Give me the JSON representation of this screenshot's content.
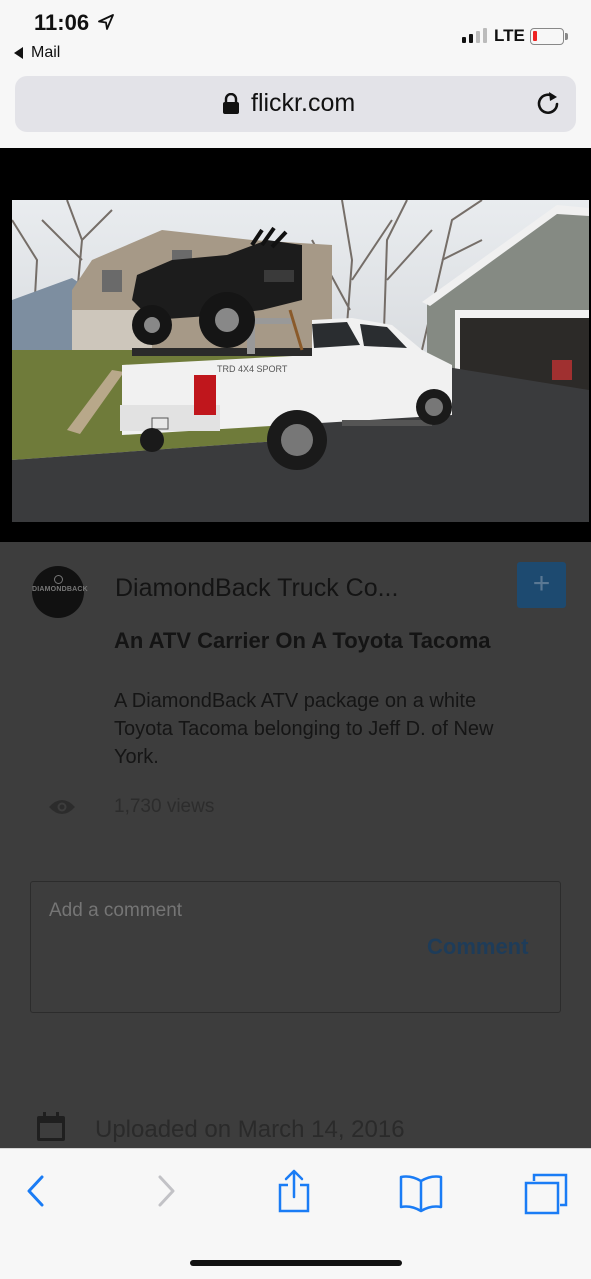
{
  "status_bar": {
    "time": "11:06",
    "back_app": "Mail",
    "carrier": "LTE",
    "battery_color": "#e22222"
  },
  "url_bar": {
    "domain": "flickr.com",
    "icons": [
      "lock-icon",
      "reload-icon"
    ]
  },
  "photo": {
    "subject": "white pickup truck carrying an ATV",
    "bed_decal": "TRD 4X4 SPORT"
  },
  "post": {
    "owner_name": "DiamondBack Truck Co...",
    "avatar_text": "DIAMONDBACK",
    "follow_symbol": "+",
    "title": "An ATV Carrier On A Toyota Tacoma",
    "description": "A DiamondBack ATV package on a white Toyota Tacoma belonging to Jeff D. of New York.",
    "views": "1,730 views",
    "comment_placeholder": "Add a comment",
    "comment_button": "Comment",
    "uploaded": "Uploaded on March 14, 2016"
  },
  "toolbar": {
    "icons": [
      "back-icon",
      "forward-icon",
      "share-icon",
      "bookmarks-icon",
      "tabs-icon"
    ],
    "accent": "#1a7cf5"
  }
}
